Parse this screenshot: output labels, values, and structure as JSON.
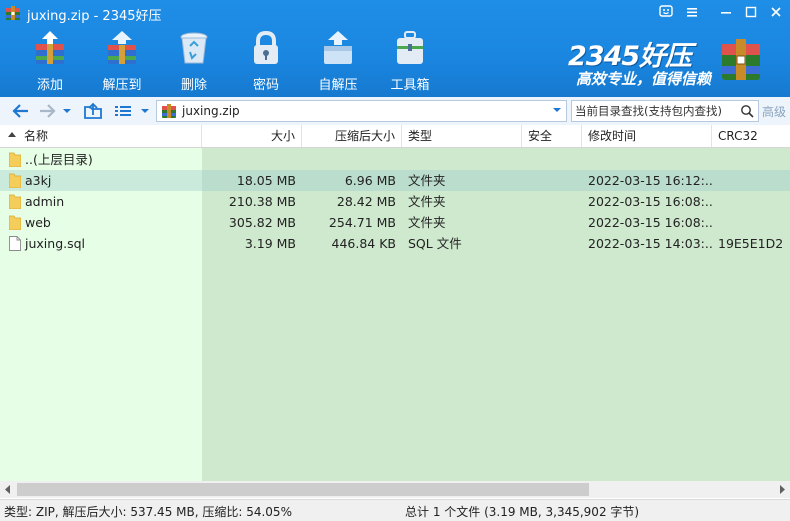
{
  "window": {
    "title": "juxing.zip - 2345好压",
    "controls": [
      "smiley-icon",
      "menu-icon",
      "minimize-icon",
      "maximize-icon",
      "close-icon"
    ]
  },
  "toolbar": {
    "buttons": [
      {
        "label": "添加",
        "icon": "add-archive-icon"
      },
      {
        "label": "解压到",
        "icon": "extract-to-icon"
      },
      {
        "label": "删除",
        "icon": "recycle-bin-icon"
      },
      {
        "label": "密码",
        "icon": "padlock-icon"
      },
      {
        "label": "自解压",
        "icon": "self-extract-icon"
      },
      {
        "label": "工具箱",
        "icon": "toolbox-icon"
      }
    ]
  },
  "brand": {
    "name": "2345好压",
    "slogan": "高效专业，值得信赖"
  },
  "addressbar": {
    "path": "juxing.zip",
    "search_placeholder": "当前目录查找(支持包内查找)",
    "advanced_search": "高级"
  },
  "columns": {
    "name": "名称",
    "size": "大小",
    "packed": "压缩后大小",
    "type": "类型",
    "security": "安全",
    "modified": "修改时间",
    "crc": "CRC32"
  },
  "files": [
    {
      "name": "..(上层目录)",
      "size": "",
      "packed": "",
      "type": "",
      "security": "",
      "modified": "",
      "crc": "",
      "icon": "folder-icon"
    },
    {
      "name": "a3kj",
      "size": "18.05 MB",
      "packed": "6.96 MB",
      "type": "文件夹",
      "security": "",
      "modified": "2022-03-15 16:12:...",
      "crc": "",
      "icon": "folder-icon"
    },
    {
      "name": "admin",
      "size": "210.38 MB",
      "packed": "28.42 MB",
      "type": "文件夹",
      "security": "",
      "modified": "2022-03-15 16:08:...",
      "crc": "",
      "icon": "folder-icon"
    },
    {
      "name": "web",
      "size": "305.82 MB",
      "packed": "254.71 MB",
      "type": "文件夹",
      "security": "",
      "modified": "2022-03-15 16:08:...",
      "crc": "",
      "icon": "folder-icon"
    },
    {
      "name": "juxing.sql",
      "size": "3.19 MB",
      "packed": "446.84 KB",
      "type": "SQL 文件",
      "security": "",
      "modified": "2022-03-15 14:03:...",
      "crc": "19E5E1D2",
      "icon": "file-icon"
    }
  ],
  "selected_row": 1,
  "status": {
    "left": "类型: ZIP, 解压后大小: 537.45 MB, 压缩比: 54.05%",
    "right": "总计 1 个文件 (3.19 MB, 3,345,902 字节)"
  },
  "colors": {
    "toolbar_bg": "#1a86e0",
    "name_col_bg": "#e6fde6",
    "data_col_bg": "#cfe9cf",
    "selected_row": "#9ccfcf"
  }
}
